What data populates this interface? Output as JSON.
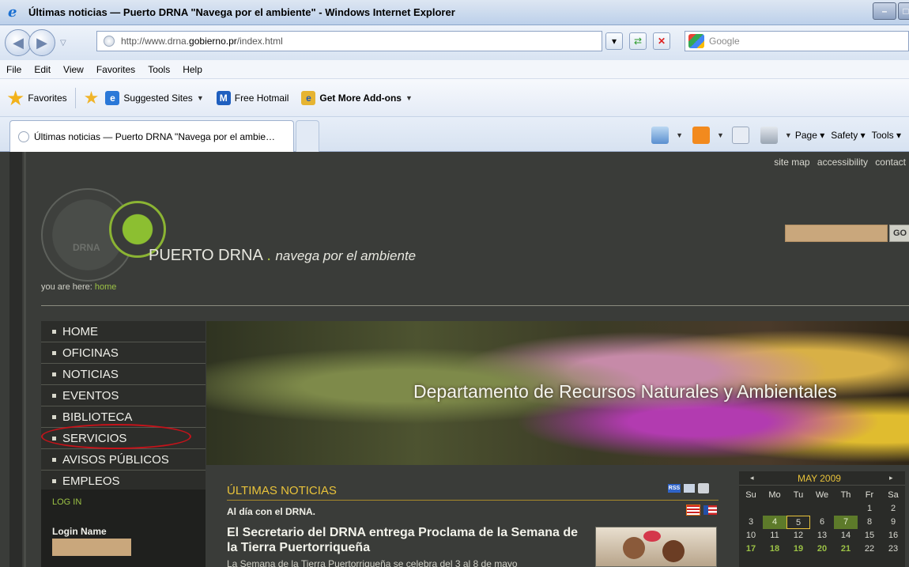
{
  "window": {
    "title": "Últimas noticias — Puerto DRNA \"Navega por el ambiente\" - Windows Internet Explorer"
  },
  "address": {
    "url_prefix": "http://www.drna.",
    "url_domain": "gobierno.pr",
    "url_suffix": "/index.html"
  },
  "search": {
    "placeholder": "Google"
  },
  "menu": [
    "File",
    "Edit",
    "View",
    "Favorites",
    "Tools",
    "Help"
  ],
  "favorites": {
    "label": "Favorites",
    "items": [
      {
        "label": "Suggested Sites",
        "icon": "ie-icon"
      },
      {
        "label": "Free Hotmail",
        "icon": "hotmail-icon"
      },
      {
        "label": "Get More Add-ons",
        "icon": "ie-icon"
      }
    ]
  },
  "tabs": {
    "active": "Últimas noticias — Puerto DRNA \"Navega por el ambie…"
  },
  "commandbar": {
    "page": "Page",
    "safety": "Safety",
    "tools": "Tools"
  },
  "site": {
    "utility_links": [
      "site map",
      "accessibility",
      "contact"
    ],
    "seal_text": "DRNA",
    "brand_name": "PUERTO DRNA",
    "brand_dot": ".",
    "brand_tagline": "navega por el ambiente",
    "go_label": "GO",
    "breadcrumb_label": "you are here:",
    "breadcrumb_home": "home",
    "nav": [
      "HOME",
      "OFICINAS",
      "NOTICIAS",
      "EVENTOS",
      "BIBLIOTECA",
      "SERVICIOS",
      "AVISOS PÚBLICOS",
      "EMPLEOS"
    ],
    "login": {
      "header": "LOG IN",
      "name_label": "Login Name"
    },
    "banner_text": "Departamento de Recursos Naturales y Ambientales",
    "news": {
      "heading": "ÚLTIMAS NOTICIAS",
      "rss_label": "RSS",
      "subheading": "Al día con el DRNA.",
      "headline": "El Secretario del DRNA entrega Proclama de la Semana de la Tierra Puertorriqueña",
      "snippet": "La Semana de la Tierra Puertorriqueña se celebra del 3 al 8 de mayo"
    },
    "calendar": {
      "prev": "◂",
      "month": "MAY 2009",
      "next": "▸",
      "days": [
        "Su",
        "Mo",
        "Tu",
        "We",
        "Th",
        "Fr",
        "Sa"
      ],
      "row1": [
        "",
        "",
        "",
        "",
        "",
        "1",
        "2"
      ],
      "row2": [
        "3",
        "4",
        "5",
        "6",
        "7",
        "8",
        "9"
      ],
      "row3": [
        "10",
        "11",
        "12",
        "13",
        "14",
        "15",
        "16"
      ],
      "row4": [
        "17",
        "18",
        "19",
        "20",
        "21",
        "22",
        "23"
      ]
    }
  }
}
